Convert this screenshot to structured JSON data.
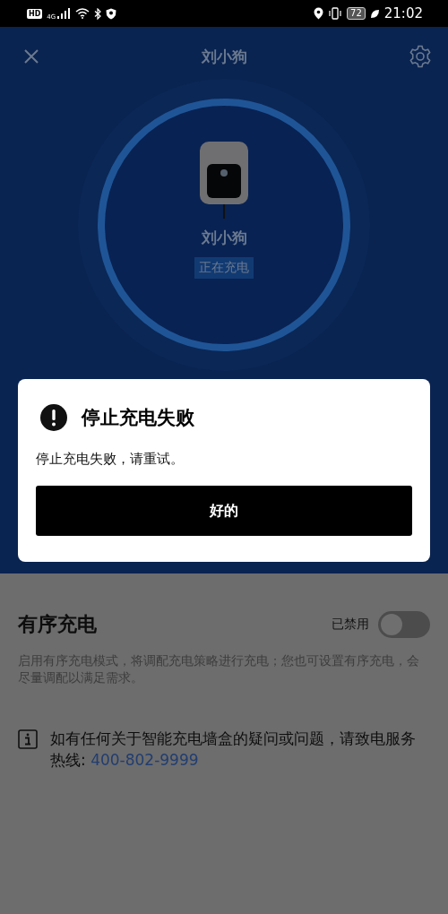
{
  "status_bar": {
    "badges": [
      "HD",
      "4G"
    ],
    "battery": "72",
    "time": "21:02"
  },
  "header": {
    "title": "刘小狗"
  },
  "device": {
    "name": "刘小狗",
    "status": "正在充电"
  },
  "ordered_charging": {
    "title": "有序充电",
    "state_label": "已禁用",
    "on": false,
    "description": "启用有序充电模式，将调配充电策略进行充电；您也可设置有序充电，会尽量调配以满足需求。"
  },
  "help": {
    "text": "如有任何关于智能充电墙盒的疑问或问题，请致电服务热线: ",
    "phone": "400-802-9999"
  },
  "dialog": {
    "title": "停止充电失败",
    "message": "停止充电失败，请重试。",
    "button": "好的"
  }
}
